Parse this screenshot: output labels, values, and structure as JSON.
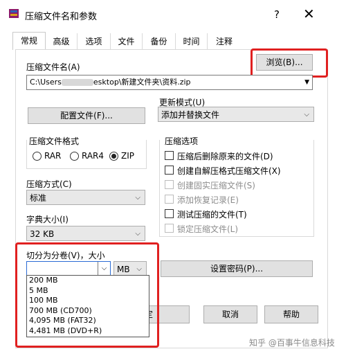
{
  "window": {
    "title": "压缩文件名和参数",
    "help_label": "?",
    "close_label": "✕"
  },
  "tabs": [
    "常规",
    "高级",
    "选项",
    "文件",
    "备份",
    "时间",
    "注释"
  ],
  "archive_name": {
    "label": "压缩文件名(A)",
    "value_prefix": "C:\\Users",
    "value_suffix": "esktop\\新建文件夹\\资料.zip",
    "browse_label": "浏览(B)..."
  },
  "update_mode": {
    "label": "更新模式(U)",
    "value": "添加并替换文件"
  },
  "profile_button": "配置文件(F)...",
  "archive_format": {
    "label": "压缩文件格式",
    "options": [
      "RAR",
      "RAR4",
      "ZIP"
    ],
    "selected": "ZIP"
  },
  "compression_method": {
    "label": "压缩方式(C)",
    "value": "标准"
  },
  "dictionary_size": {
    "label": "字典大小(I)",
    "value": "32 KB"
  },
  "split_volume": {
    "label": "切分为分卷(V)，大小",
    "value": "",
    "unit": "MB",
    "options": [
      "200 MB",
      "5 MB",
      "100 MB",
      "700 MB  (CD700)",
      "4,095 MB  (FAT32)",
      "4,481 MB  (DVD+R)"
    ]
  },
  "compression_options": {
    "label": "压缩选项",
    "items": [
      {
        "label": "压缩后删除原来的文件(D)",
        "enabled": true
      },
      {
        "label": "创建自解压格式压缩文件(X)",
        "enabled": true
      },
      {
        "label": "创建固实压缩文件(S)",
        "enabled": false
      },
      {
        "label": "添加恢复记录(E)",
        "enabled": false
      },
      {
        "label": "测试压缩的文件(T)",
        "enabled": true
      },
      {
        "label": "锁定压缩文件(L)",
        "enabled": false
      }
    ]
  },
  "set_password_button": "设置密码(P)...",
  "footer": {
    "ok_fragment": "定",
    "cancel_label": "取消",
    "help_label": "帮助"
  },
  "watermark": "知乎 @百事牛信息科技",
  "colors": {
    "highlight": "#e02020",
    "disabled_text": "#8d8d8d"
  }
}
